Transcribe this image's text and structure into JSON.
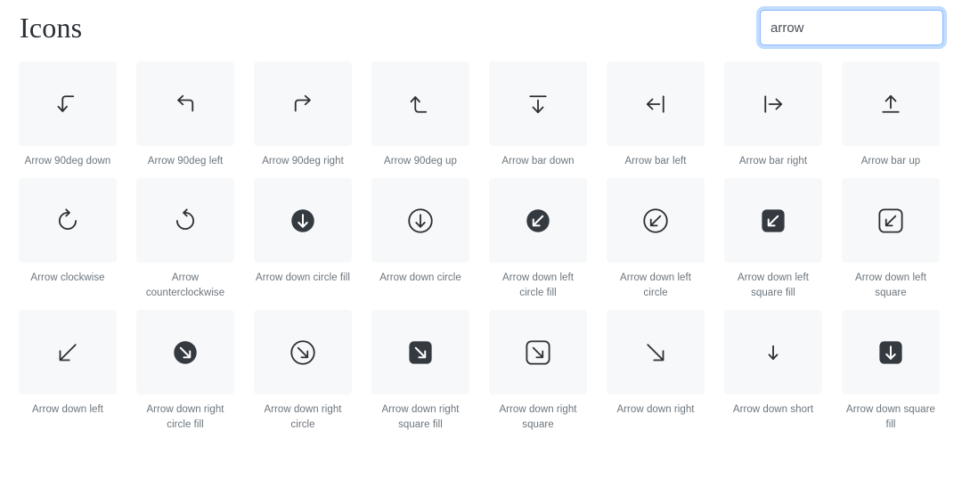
{
  "header": {
    "title": "Icons",
    "search": {
      "value": "arrow",
      "placeholder": "Search icons..."
    }
  },
  "grid": {
    "columns": 8,
    "colors": {
      "tile_background": "#f7f8f9",
      "icon_stroke": "#2b3035",
      "icon_fill_dark": "#343a40",
      "icon_fill_light": "#ffffff",
      "caption_text": "#6c757d",
      "title_text": "#2b2f36",
      "focus_border": "#86b7fe",
      "focus_glow": "rgba(13,110,253,0.25)",
      "page_background": "#ffffff"
    },
    "items": [
      {
        "icon": "arrow-90deg-down-icon",
        "label": "Arrow 90deg down"
      },
      {
        "icon": "arrow-90deg-left-icon",
        "label": "Arrow 90deg left"
      },
      {
        "icon": "arrow-90deg-right-icon",
        "label": "Arrow 90deg right"
      },
      {
        "icon": "arrow-90deg-up-icon",
        "label": "Arrow 90deg up"
      },
      {
        "icon": "arrow-bar-down-icon",
        "label": "Arrow bar down"
      },
      {
        "icon": "arrow-bar-left-icon",
        "label": "Arrow bar left"
      },
      {
        "icon": "arrow-bar-right-icon",
        "label": "Arrow bar right"
      },
      {
        "icon": "arrow-bar-up-icon",
        "label": "Arrow bar up"
      },
      {
        "icon": "arrow-clockwise-icon",
        "label": "Arrow clockwise"
      },
      {
        "icon": "arrow-counterclockwise-icon",
        "label": "Arrow counterclockwise"
      },
      {
        "icon": "arrow-down-circle-fill-icon",
        "label": "Arrow down circle fill"
      },
      {
        "icon": "arrow-down-circle-icon",
        "label": "Arrow down circle"
      },
      {
        "icon": "arrow-down-left-circle-fill-icon",
        "label": "Arrow down left circle fill"
      },
      {
        "icon": "arrow-down-left-circle-icon",
        "label": "Arrow down left circle"
      },
      {
        "icon": "arrow-down-left-square-fill-icon",
        "label": "Arrow down left square fill"
      },
      {
        "icon": "arrow-down-left-square-icon",
        "label": "Arrow down left square"
      },
      {
        "icon": "arrow-down-left-icon",
        "label": "Arrow down left"
      },
      {
        "icon": "arrow-down-right-circle-fill-icon",
        "label": "Arrow down right circle fill"
      },
      {
        "icon": "arrow-down-right-circle-icon",
        "label": "Arrow down right circle"
      },
      {
        "icon": "arrow-down-right-square-fill-icon",
        "label": "Arrow down right square fill"
      },
      {
        "icon": "arrow-down-right-square-icon",
        "label": "Arrow down right square"
      },
      {
        "icon": "arrow-down-right-icon",
        "label": "Arrow down right"
      },
      {
        "icon": "arrow-down-short-icon",
        "label": "Arrow down short"
      },
      {
        "icon": "arrow-down-square-fill-icon",
        "label": "Arrow down square fill"
      }
    ]
  }
}
